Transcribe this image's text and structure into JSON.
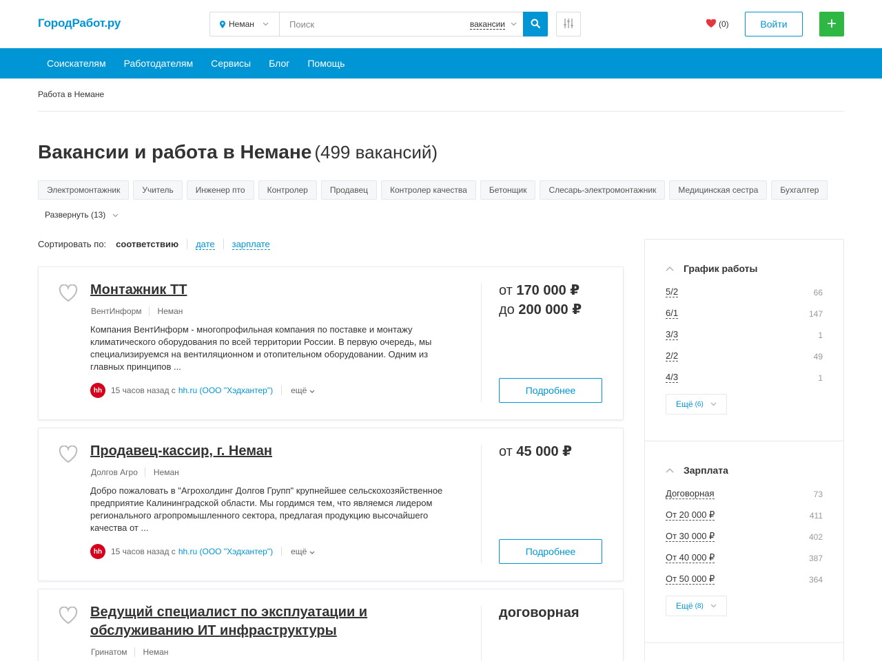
{
  "header": {
    "logo": "ГородРабот.ру",
    "city": "Неман",
    "search_placeholder": "Поиск",
    "search_type": "вакансии",
    "favorites_count": "(0)",
    "login": "Войти",
    "add": "+"
  },
  "nav": [
    "Соискателям",
    "Работодателям",
    "Сервисы",
    "Блог",
    "Помощь"
  ],
  "breadcrumb": "Работа в Немане",
  "page": {
    "title": "Вакансии и работа в Немане",
    "count": "(499 вакансий)"
  },
  "tags": [
    "Электромонтажник",
    "Учитель",
    "Инженер пто",
    "Контролер",
    "Продавец",
    "Контролер качества",
    "Бетонщик",
    "Слесарь-электромонтажник",
    "Медицинская сестра",
    "Бухгалтер"
  ],
  "expand": "Развернуть (13)",
  "sort": {
    "label": "Сортировать по:",
    "current": "соответствию",
    "options": [
      "дате",
      "зарплате"
    ]
  },
  "vacancies": [
    {
      "title": "Монтажник ТТ",
      "company": "ВентИнформ",
      "city": "Неман",
      "description": "Компания ВентИнформ - многопрофильная компания по поставке и монтажу климатического оборудования по всей территории России. В первую очередь, мы специализируемся на вентиляционном и отопительном оборудовании. Одним из главных принципов ...",
      "time": "15 часов назад с",
      "source": "hh.ru (ООО \"Хэдхантер\")",
      "more": "ещё",
      "salary_from_label": "от",
      "salary_from": "170 000 ₽",
      "salary_to_label": "до",
      "salary_to": "200 000 ₽",
      "details": "Подробнее"
    },
    {
      "title": "Продавец-кассир, г. Неман",
      "company": "Долгов Агро",
      "city": "Неман",
      "description": "Добро пожаловать в \"Агрохолдинг Долгов Групп\" крупнейшее сельскохозяйственное предприятие Калининградской области. Мы гордимся тем, что являемся лидером регионального агропромышленного сектора, предлагая продукцию высочайшего качества от ...",
      "time": "15 часов назад с",
      "source": "hh.ru (ООО \"Хэдхантер\")",
      "more": "ещё",
      "salary_from_label": "от",
      "salary_from": "45 000 ₽",
      "details": "Подробнее"
    },
    {
      "title": "Ведущий специалист по эксплуатации и обслуживанию ИТ инфраструктуры",
      "company": "Гринатом",
      "city": "Неман",
      "salary_text": "договорная"
    }
  ],
  "filters": {
    "schedule": {
      "title": "График работы",
      "items": [
        {
          "k": "5/2",
          "v": "66"
        },
        {
          "k": "6/1",
          "v": "147"
        },
        {
          "k": "3/3",
          "v": "1"
        },
        {
          "k": "2/2",
          "v": "49"
        },
        {
          "k": "4/3",
          "v": "1"
        }
      ],
      "more": "Ещё",
      "more_count": "(6)"
    },
    "salary": {
      "title": "Зарплата",
      "items": [
        {
          "k": "Договорная",
          "v": "73"
        },
        {
          "k": "От 20 000 ₽",
          "v": "411"
        },
        {
          "k": "От 30 000 ₽",
          "v": "402"
        },
        {
          "k": "От 40 000 ₽",
          "v": "387"
        },
        {
          "k": "От 50 000 ₽",
          "v": "364"
        }
      ],
      "more": "Ещё",
      "more_count": "(8)"
    }
  },
  "colors": {
    "brand": "#0096d6",
    "add_button": "#2eb843",
    "favorite": "#e8343d",
    "hh_logo": "#d6001c"
  }
}
